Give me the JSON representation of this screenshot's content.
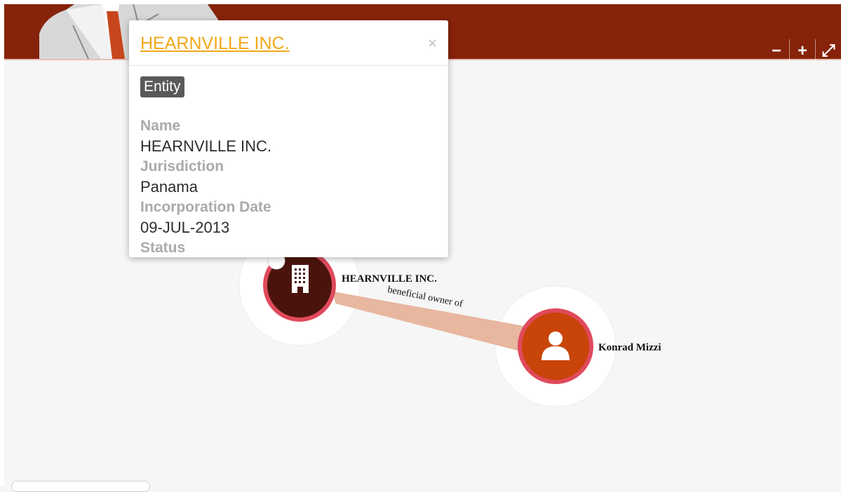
{
  "header": {
    "zoom_out_label": "−",
    "zoom_in_label": "+",
    "fullscreen_label": "⤢"
  },
  "popover": {
    "title": "HEARNVILLE INC.",
    "close_label": "×",
    "badge": "Entity",
    "fields": [
      {
        "label": "Name",
        "value": "HEARNVILLE INC."
      },
      {
        "label": "Jurisdiction",
        "value": "Panama"
      },
      {
        "label": "Incorporation Date",
        "value": "09-JUL-2013"
      },
      {
        "label": "Status",
        "value": ""
      }
    ]
  },
  "graph": {
    "nodes": [
      {
        "label": "HEARNVILLE INC.",
        "type": "entity",
        "icon": "building-icon",
        "color": "#4a140c"
      },
      {
        "label": "Konrad Mizzi",
        "type": "officer",
        "icon": "person-icon",
        "color": "#c84408"
      }
    ],
    "edges": [
      {
        "label": "beneficial owner of",
        "color": "#e8b7a0"
      }
    ],
    "ring_color": "#e04a5c"
  }
}
